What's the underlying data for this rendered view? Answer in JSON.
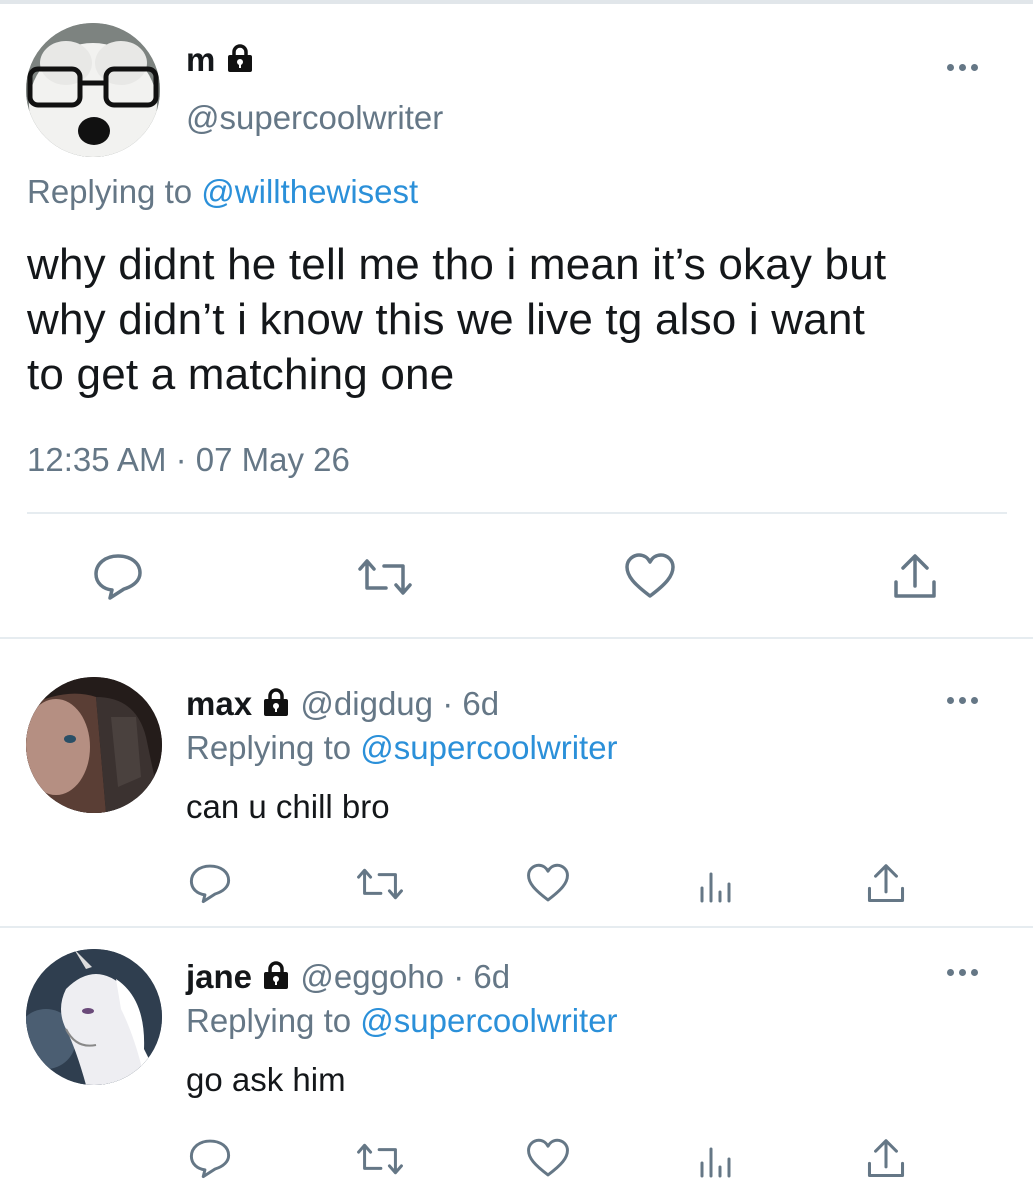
{
  "main_tweet": {
    "name": "m",
    "handle": "@supercoolwriter",
    "replying_prefix": "Replying to",
    "replying_to": "@willthewisest",
    "text_line1": "why didnt he tell me tho i mean it’s okay but",
    "text_line2": "why didn’t i know this we live tg also i want",
    "text_line3": "to get a matching one",
    "timestamp": "12:35 AM · 07 May 26",
    "avatar_icon": "panda-glasses-avatar"
  },
  "replies": [
    {
      "name": "max",
      "handle": "@digdug",
      "age": "· 6d",
      "replying_prefix": "Replying to",
      "replying_to": "@supercoolwriter",
      "text": "can u chill bro",
      "avatar_icon": "person-avatar"
    },
    {
      "name": "jane",
      "handle": "@eggoho",
      "age": "· 6d",
      "replying_prefix": "Replying to",
      "replying_to": "@supercoolwriter",
      "text": "go ask him",
      "avatar_icon": "unicorn-avatar"
    }
  ],
  "colors": {
    "link": "#2b90d9",
    "secondary": "#657786",
    "text": "#14171a",
    "divider": "#e6ecf0"
  },
  "icons": [
    "reply-icon",
    "retweet-icon",
    "like-icon",
    "analytics-icon",
    "share-icon",
    "more-icon",
    "lock-icon"
  ]
}
